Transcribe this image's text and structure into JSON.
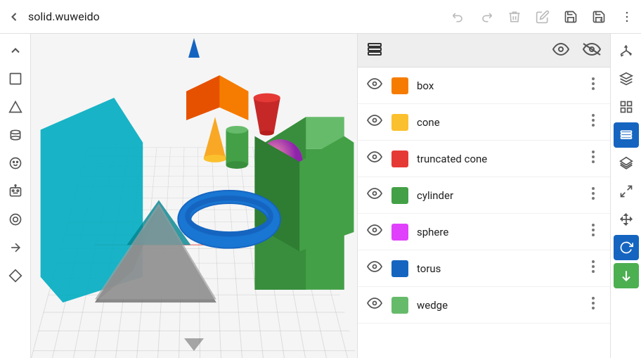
{
  "topbar": {
    "title": "solid.wuweido",
    "back_icon": "←",
    "undo_icon": "↩",
    "redo_icon": "↪",
    "delete_icon": "🗑",
    "edit_icon": "✏",
    "save_icon": "💾",
    "save_as_icon": "📋",
    "more_icon": "⋮"
  },
  "left_tools": [
    {
      "name": "pan-up",
      "icon": "∧"
    },
    {
      "name": "box-tool",
      "icon": "□"
    },
    {
      "name": "triangle-tool",
      "icon": "△"
    },
    {
      "name": "cylinder-tool",
      "icon": "⊙"
    },
    {
      "name": "face-tool",
      "icon": "☺"
    },
    {
      "name": "ring-tool",
      "icon": "◎"
    },
    {
      "name": "arrow-tool",
      "icon": "➤"
    },
    {
      "name": "diamond-tool",
      "icon": "◇"
    }
  ],
  "panel": {
    "header_icon": "☰",
    "items": [
      {
        "name": "box",
        "label": "box",
        "color": "#f57c00",
        "visible": true
      },
      {
        "name": "cone",
        "label": "cone",
        "color": "#fbc02d",
        "visible": true
      },
      {
        "name": "truncated-cone",
        "label": "truncated cone",
        "color": "#e53935",
        "visible": true
      },
      {
        "name": "cylinder",
        "label": "cylinder",
        "color": "#43a047",
        "visible": true
      },
      {
        "name": "sphere",
        "label": "sphere",
        "color": "#e040fb",
        "visible": true
      },
      {
        "name": "torus",
        "label": "torus",
        "color": "#1565c0",
        "visible": true
      },
      {
        "name": "wedge",
        "label": "wedge",
        "color": "#66bb6a",
        "visible": true
      }
    ]
  },
  "right_tools": [
    {
      "name": "axes-tool",
      "icon": "⊹",
      "active": false
    },
    {
      "name": "object-tool",
      "icon": "⬡",
      "active": false
    },
    {
      "name": "grid-tool",
      "icon": "⊞",
      "active": false
    },
    {
      "name": "layers-tool",
      "icon": "☰",
      "active": true
    },
    {
      "name": "stack-tool",
      "icon": "⧉",
      "active": false
    },
    {
      "name": "expand-tool",
      "icon": "⤢",
      "active": false
    },
    {
      "name": "move-tool",
      "icon": "✛",
      "active": false
    },
    {
      "name": "rotate-tool",
      "icon": "↺",
      "active": true,
      "accent": true
    },
    {
      "name": "arrow-down-tool",
      "icon": "↓",
      "active": false,
      "accent": true
    }
  ]
}
